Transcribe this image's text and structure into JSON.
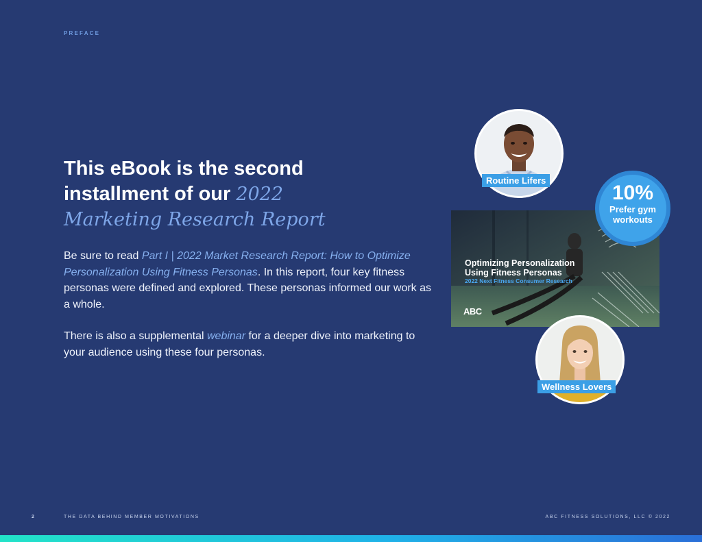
{
  "header": {
    "section": "PREFACE"
  },
  "headline": {
    "line1": "This eBook is the second",
    "line2_prefix": "installment of our ",
    "line2_accent": "2022",
    "line3_accent": "Marketing Research Report"
  },
  "body": {
    "p1_prefix": "Be sure to read ",
    "p1_link": "Part I | 2022 Market Research Report: How to Optimize Personalization Using Fitness Personas",
    "p1_suffix": ". In this report, four key fitness personas were defined and explored. These personas informed our work as a whole.",
    "p2_prefix": "There is also a supplemental ",
    "p2_link": "webinar",
    "p2_suffix": " for a deeper dive into marketing to your audience using these four personas."
  },
  "cover": {
    "title_line1": "Optimizing Personalization",
    "title_line2": "Using Fitness Personas",
    "subtitle": "2022 Next Fitness Consumer Research",
    "logo": "ABC"
  },
  "personas": [
    {
      "label": "Routine Lifers"
    },
    {
      "label": "Wellness Lovers"
    }
  ],
  "stat": {
    "value": "10%",
    "label_line1": "Prefer gym",
    "label_line2": "workouts"
  },
  "footer": {
    "page_number": "2",
    "left": "THE DATA BEHIND MEMBER MOTIVATIONS",
    "right": "ABC FITNESS SOLUTIONS, LLC © 2022"
  },
  "colors": {
    "background": "#263a72",
    "accent_text": "#7ea6e8",
    "tag_blue": "#3b9fe6",
    "bar_start": "#22e3c8",
    "bar_end": "#2a6fd8"
  }
}
